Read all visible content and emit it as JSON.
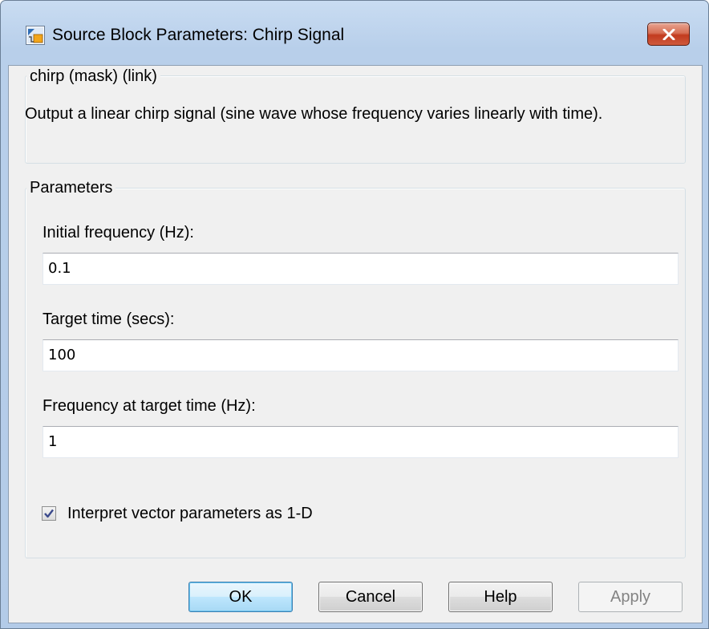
{
  "window": {
    "title": "Source Block Parameters: Chirp Signal",
    "close_icon": "close-x-icon",
    "app_icon": "simulink-block-icon"
  },
  "description": {
    "group_title": "chirp (mask) (link)",
    "text": "Output a linear chirp signal (sine wave  whose frequency varies linearly with time)."
  },
  "parameters": {
    "group_title": "Parameters",
    "initial_frequency": {
      "label": "Initial frequency (Hz):",
      "value": "0.1"
    },
    "target_time": {
      "label": "Target time (secs):",
      "value": "100"
    },
    "frequency_at_target": {
      "label": "Frequency at target time (Hz):",
      "value": "1"
    },
    "interpret_vector": {
      "label": "Interpret vector parameters as 1-D",
      "checked": true
    }
  },
  "buttons": {
    "ok": "OK",
    "cancel": "Cancel",
    "help": "Help",
    "apply": "Apply"
  },
  "colors": {
    "window_frame": "#b8cfea",
    "client_bg": "#f0f0f0",
    "close_button": "#c23b1f",
    "default_button_border": "#3c7fb1"
  }
}
